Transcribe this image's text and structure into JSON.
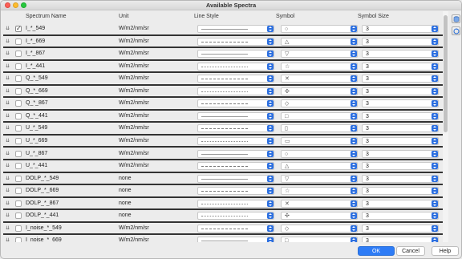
{
  "window": {
    "title": "Available Spectra"
  },
  "columns": {
    "name": "Spectrum Name",
    "unit": "Unit",
    "line_style": "Line Style",
    "symbol": "Symbol",
    "symbol_size": "Symbol Size"
  },
  "rows": [
    {
      "name": "I_*_549",
      "unit": "W/m2/nm/sr",
      "checked": true,
      "line_style": "solid",
      "symbol": "○",
      "size": "3"
    },
    {
      "name": "I_*_669",
      "unit": "W/m2/nm/sr",
      "checked": false,
      "line_style": "dashed",
      "symbol": "△",
      "size": "3"
    },
    {
      "name": "I_*_867",
      "unit": "W/m2/nm/sr",
      "checked": false,
      "line_style": "solid",
      "symbol": "▽",
      "size": "3"
    },
    {
      "name": "I_*_441",
      "unit": "W/m2/nm/sr",
      "checked": false,
      "line_style": "dotted",
      "symbol": "☆",
      "size": "3"
    },
    {
      "name": "Q_*_549",
      "unit": "W/m2/nm/sr",
      "checked": false,
      "line_style": "dashed",
      "symbol": "✕",
      "size": "3"
    },
    {
      "name": "Q_*_669",
      "unit": "W/m2/nm/sr",
      "checked": false,
      "line_style": "dotted",
      "symbol": "✣",
      "size": "3"
    },
    {
      "name": "Q_*_867",
      "unit": "W/m2/nm/sr",
      "checked": false,
      "line_style": "dashed",
      "symbol": "◇",
      "size": "3"
    },
    {
      "name": "Q_*_441",
      "unit": "W/m2/nm/sr",
      "checked": false,
      "line_style": "solid",
      "symbol": "□",
      "size": "3"
    },
    {
      "name": "U_*_549",
      "unit": "W/m2/nm/sr",
      "checked": false,
      "line_style": "dashed",
      "symbol": "▯",
      "size": "3"
    },
    {
      "name": "U_*_669",
      "unit": "W/m2/nm/sr",
      "checked": false,
      "line_style": "dotted",
      "symbol": "▭",
      "size": "3"
    },
    {
      "name": "U_*_867",
      "unit": "W/m2/nm/sr",
      "checked": false,
      "line_style": "solid",
      "symbol": "○",
      "size": "3"
    },
    {
      "name": "U_*_441",
      "unit": "W/m2/nm/sr",
      "checked": false,
      "line_style": "dashed",
      "symbol": "△",
      "size": "3"
    },
    {
      "name": "DOLP_*_549",
      "unit": "none",
      "checked": false,
      "line_style": "solid",
      "symbol": "▽",
      "size": "3"
    },
    {
      "name": "DOLP_*_669",
      "unit": "none",
      "checked": false,
      "line_style": "dashed",
      "symbol": "☆",
      "size": "3"
    },
    {
      "name": "DOLP_*_867",
      "unit": "none",
      "checked": false,
      "line_style": "dotted",
      "symbol": "✕",
      "size": "3"
    },
    {
      "name": "DOLP_*_441",
      "unit": "none",
      "checked": false,
      "line_style": "dotted",
      "symbol": "✣",
      "size": "3"
    },
    {
      "name": "I_noise_*_549",
      "unit": "W/m2/nm/sr",
      "checked": false,
      "line_style": "dashed",
      "symbol": "◇",
      "size": "3"
    },
    {
      "name": "I_noise_*_669",
      "unit": "W/m2/nm/sr",
      "checked": false,
      "line_style": "solid",
      "symbol": "□",
      "size": "3"
    }
  ],
  "icons": {
    "expander": "chevron-down-icon",
    "stepper": "up-down-stepper-icon",
    "side_button_1": "database-icon",
    "side_button_2": "refresh-icon"
  },
  "footer": {
    "ok_label": "OK",
    "cancel_label": "Cancel",
    "help_label": "Help"
  },
  "colors": {
    "accent": "#2e7cf6",
    "stepper": "#2c6fe0",
    "row_separator": "#333333"
  }
}
